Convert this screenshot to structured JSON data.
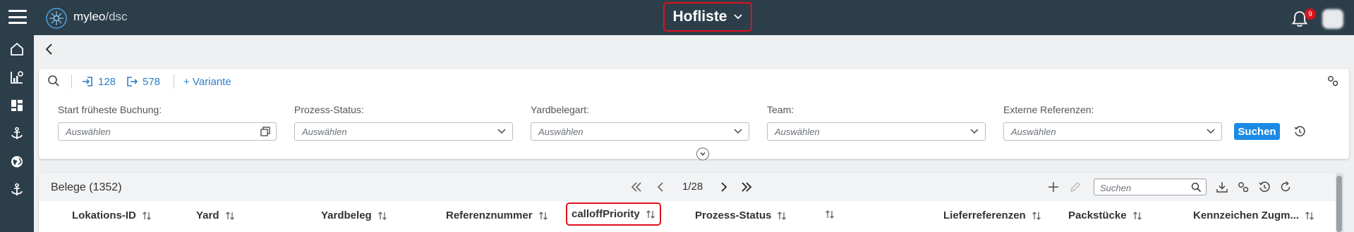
{
  "header": {
    "logo_name": "myleo",
    "logo_sep": "/",
    "logo_suffix": "dsc",
    "title": "Hofliste",
    "notification_count": "9"
  },
  "sidebar": {
    "items": [
      {
        "icon": "home-icon"
      },
      {
        "icon": "chart-icon"
      },
      {
        "icon": "dashboard-icon"
      },
      {
        "icon": "anchor-icon"
      },
      {
        "icon": "globe-icon"
      },
      {
        "icon": "anchor-icon"
      }
    ]
  },
  "filter_bar": {
    "inbound_count": "128",
    "outbound_count": "578",
    "variant_label": "+ Variante",
    "fields": [
      {
        "label": "Start früheste Buchung:",
        "placeholder": "Auswählen",
        "icon": "date-picker-icon"
      },
      {
        "label": "Prozess-Status:",
        "placeholder": "Auswählen",
        "icon": "chevron-down-icon"
      },
      {
        "label": "Yardbelegart:",
        "placeholder": "Auswählen",
        "icon": "chevron-down-icon"
      },
      {
        "label": "Team:",
        "placeholder": "Auswählen",
        "icon": "chevron-down-icon"
      },
      {
        "label": "Externe Referenzen:",
        "placeholder": "Auswählen",
        "icon": "chevron-down-icon"
      }
    ],
    "search_button": "Suchen"
  },
  "table": {
    "title": "Belege (1352)",
    "pagination": "1/28",
    "search_placeholder": "Suchen",
    "columns": [
      {
        "label": "Lokations-ID"
      },
      {
        "label": "Yard"
      },
      {
        "label": "Yardbeleg"
      },
      {
        "label": "Referenznummer"
      },
      {
        "label": "calloffPriority"
      },
      {
        "label": "Prozess-Status"
      },
      {
        "label": ""
      },
      {
        "label": "Lieferreferenzen"
      },
      {
        "label": "Packstücke"
      },
      {
        "label": "Kennzeichen Zugm..."
      }
    ]
  },
  "colors": {
    "topbar": "#2d3e4b",
    "accent": "#1a8ae5",
    "link": "#2e7fc9",
    "highlight": "#e0101d"
  }
}
